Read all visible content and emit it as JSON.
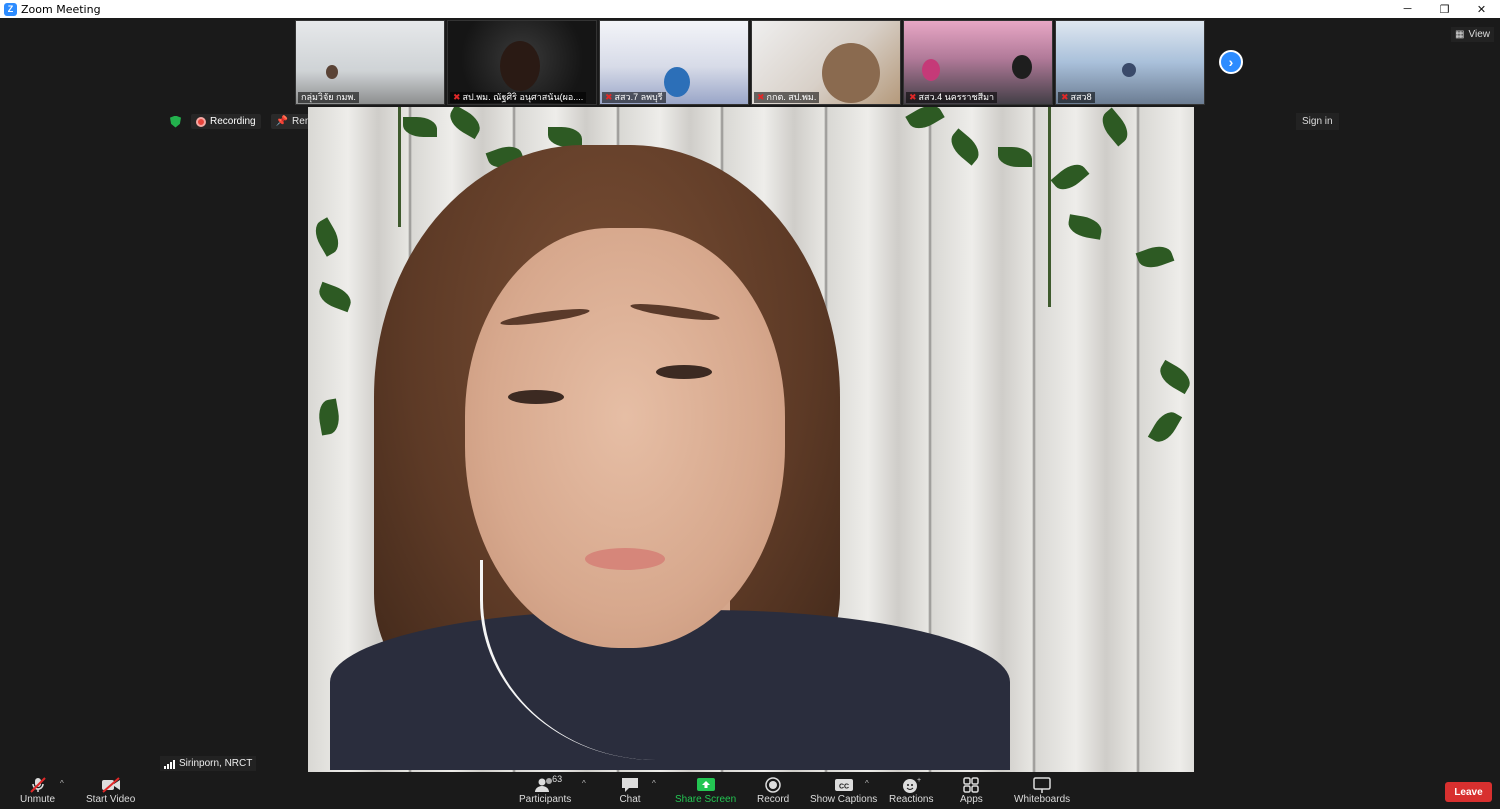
{
  "window": {
    "title": "Zoom Meeting",
    "controls": [
      "─",
      "❐",
      "✕"
    ]
  },
  "gallery": {
    "thumbnails": [
      {
        "label": "กลุ่มวิจัย กมพ.",
        "muted": false
      },
      {
        "label": "สป.พม. ณัฐศิริ อนุศาสนัน(ผอ....",
        "muted": true
      },
      {
        "label": "สสว.7 ลพบุรี",
        "muted": true
      },
      {
        "label": "กกต. สป.พม.",
        "muted": true
      },
      {
        "label": "สสว.4 นครราชสีมา",
        "muted": true
      },
      {
        "label": "สสว8",
        "muted": true
      }
    ],
    "next_icon": "›",
    "view_label": "View"
  },
  "status": {
    "recording_label": "Recording",
    "remove_pin_label": "Remove Pin",
    "sign_in_label": "Sign in"
  },
  "speaker": {
    "name": "Sirinporn, NRCT"
  },
  "toolbar": {
    "unmute": "Unmute",
    "start_video": "Start Video",
    "participants": "Participants",
    "participants_count": "63",
    "chat": "Chat",
    "share_screen": "Share Screen",
    "record": "Record",
    "show_captions": "Show Captions",
    "reactions": "Reactions",
    "apps": "Apps",
    "whiteboards": "Whiteboards",
    "leave": "Leave"
  }
}
